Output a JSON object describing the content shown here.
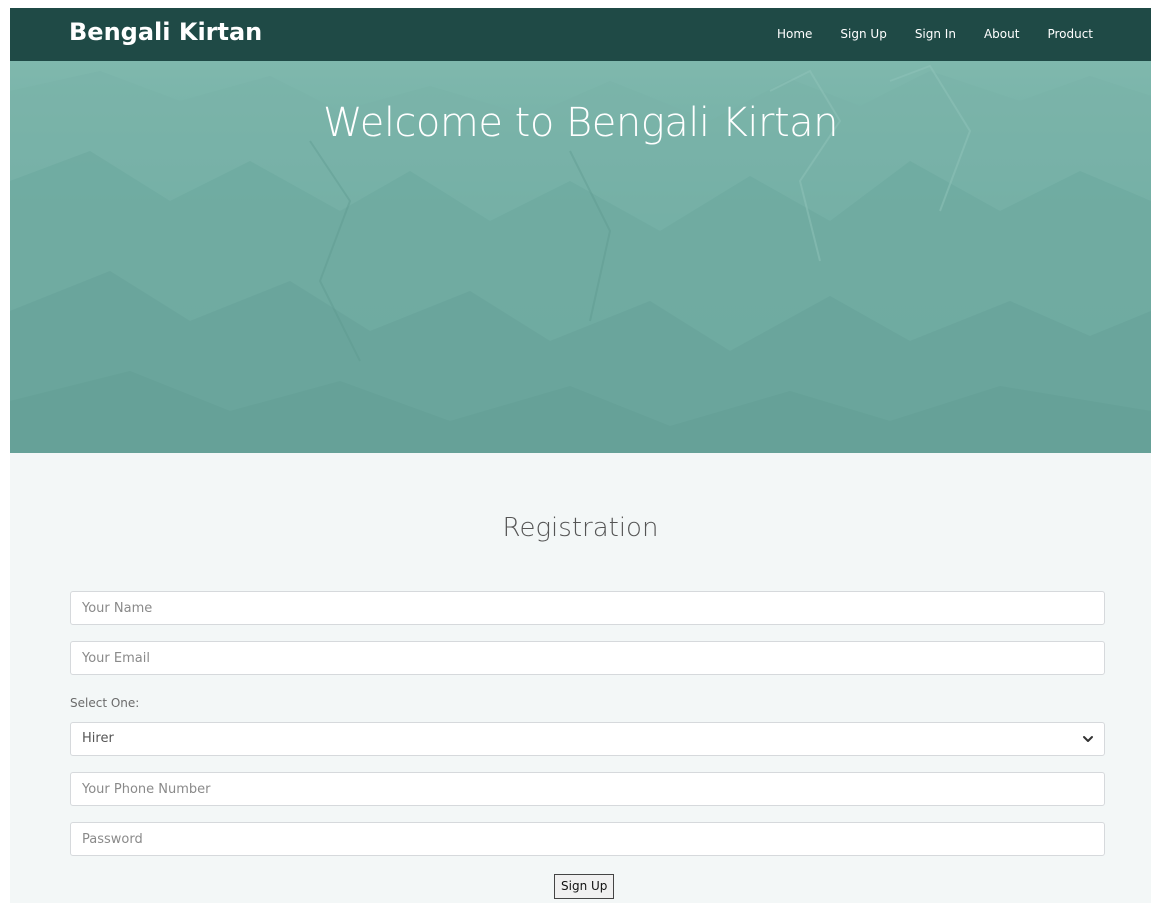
{
  "navbar": {
    "brand": "Bengali Kirtan",
    "links": [
      "Home",
      "Sign Up",
      "Sign In",
      "About",
      "Product"
    ]
  },
  "hero": {
    "title": "Welcome to Bengali Kirtan"
  },
  "form": {
    "title": "Registration",
    "name_placeholder": "Your Name",
    "email_placeholder": "Your Email",
    "select_label": "Select One:",
    "select_value": "Hirer",
    "phone_placeholder": "Your Phone Number",
    "password_placeholder": "Password",
    "submit_label": "Sign Up"
  },
  "colors": {
    "navbar_bg": "#1f4a46",
    "hero_bg": "#6ba89f",
    "page_bg": "#f3f7f7"
  },
  "icons": {
    "select_arrow": "chevron-down-icon"
  }
}
